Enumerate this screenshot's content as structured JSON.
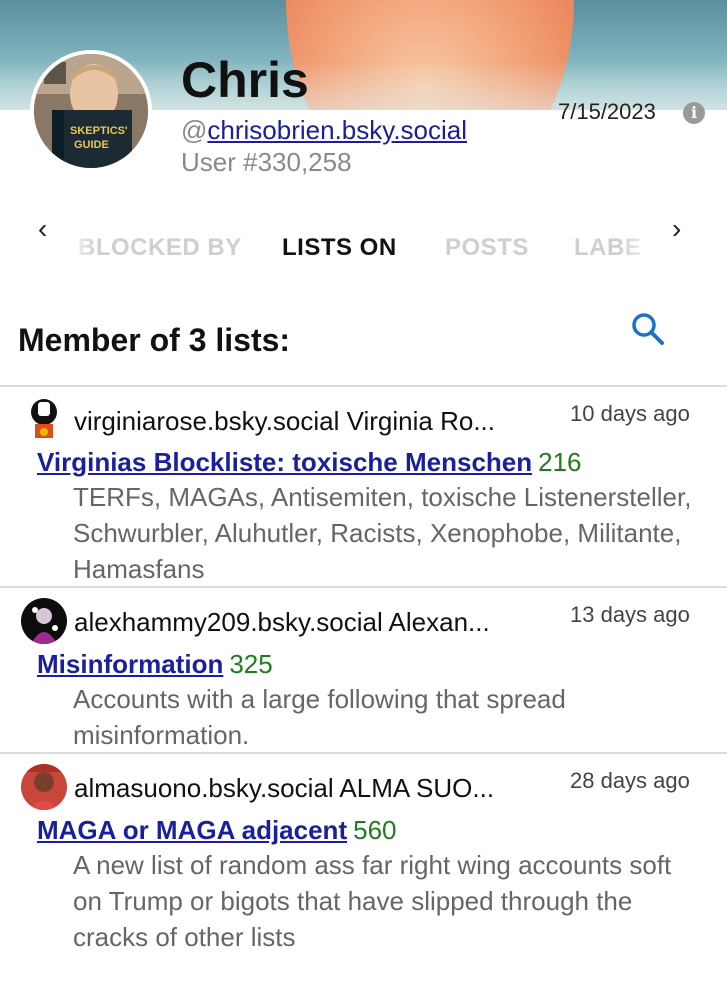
{
  "profile": {
    "name": "Chris",
    "handle_prefix": "@",
    "handle": "chrisobrien.bsky.social",
    "user_number": "User #330,258",
    "date": "7/15/2023"
  },
  "tabs": {
    "prev_label": "‹",
    "next_label": "›",
    "items": [
      "BLOCKED BY",
      "LISTS ON",
      "POSTS",
      "LABE"
    ],
    "active": "LISTS ON"
  },
  "section": {
    "title": "Member of 3 lists:"
  },
  "lists": [
    {
      "owner": "virginiarose.bsky.social Virginia Ro...",
      "age": "10 days ago",
      "title": "Virginias Blockliste: toxische Menschen",
      "count": "216",
      "description": "TERFs, MAGAs, Antisemiten, toxische Listenersteller, Schwurbler, Aluhutler, Racists, Xenophobe, Militante, Hamasfans"
    },
    {
      "owner": "alexhammy209.bsky.social Alexan...",
      "age": "13 days ago",
      "title": "Misinformation",
      "count": "325",
      "description": "Accounts with a large following that spread misinformation."
    },
    {
      "owner": "almasuono.bsky.social ALMA SUO...",
      "age": "28 days ago",
      "title": "MAGA or MAGA adjacent",
      "count": "560",
      "description": "A new list of random ass far right wing accounts soft on Trump or bigots that have slipped through the cracks of other lists"
    }
  ],
  "colors": {
    "link": "#1a1f9c",
    "count": "#1f7d1f",
    "search_icon": "#1a73c8",
    "muted": "#8a8a8a"
  },
  "icons": {
    "search": "search-icon",
    "info": "info-icon",
    "prev": "chevron-left-icon",
    "next": "chevron-right-icon"
  }
}
